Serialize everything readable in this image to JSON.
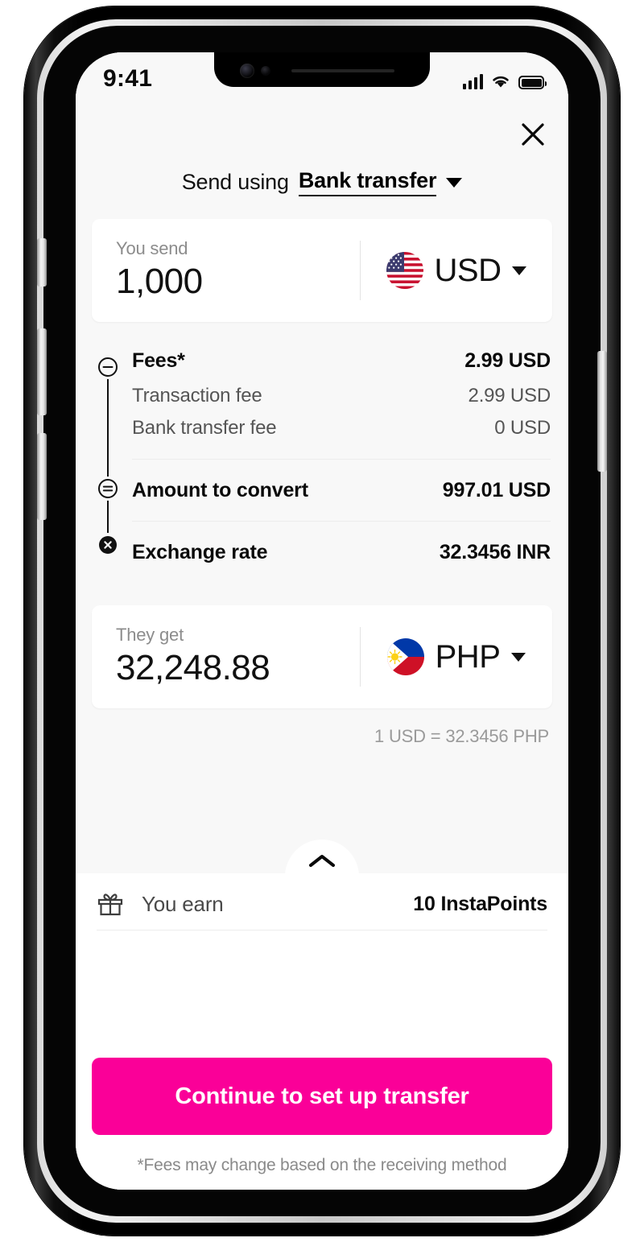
{
  "status_bar": {
    "time": "9:41",
    "signal_icon": "cellular-bars-icon",
    "wifi_icon": "wifi-icon",
    "battery_icon": "battery-icon"
  },
  "header": {
    "close_icon": "close-icon",
    "send_using_label": "Send using",
    "method_value": "Bank transfer",
    "method_caret_icon": "chevron-down-icon"
  },
  "send_card": {
    "label": "You send",
    "amount": "1,000",
    "currency": "USD",
    "flag_icon": "flag-usa-icon",
    "caret_icon": "chevron-down-icon"
  },
  "breakdown": {
    "fees": {
      "label": "Fees*",
      "value": "2.99 USD",
      "op_icon": "minus-circle-icon"
    },
    "sub_rows": [
      {
        "label": "Transaction fee",
        "value": "2.99 USD"
      },
      {
        "label": "Bank transfer fee",
        "value": "0 USD"
      }
    ],
    "amount_to_convert": {
      "label": "Amount to convert",
      "value": "997.01 USD",
      "op_icon": "equals-circle-icon"
    },
    "exchange_rate": {
      "label": "Exchange rate",
      "value": "32.3456 INR",
      "op_icon": "times-circle-icon"
    }
  },
  "receive_card": {
    "label": "They get",
    "amount": "32,248.88",
    "currency": "PHP",
    "flag_icon": "flag-philippines-icon",
    "caret_icon": "chevron-down-icon"
  },
  "rate_note": "1 USD = 32.3456 PHP",
  "earn": {
    "gift_icon": "gift-icon",
    "label": "You earn",
    "value": "10 InstaPoints",
    "expand_icon": "chevron-up-icon"
  },
  "footer": {
    "cta_label": "Continue to set up transfer",
    "disclaimer": "*Fees may change based on the receiving method"
  },
  "colors": {
    "accent": "#FA0098",
    "sheet_bg": "#F8F8F8",
    "text": "#111111",
    "muted": "#8C8C8C"
  }
}
